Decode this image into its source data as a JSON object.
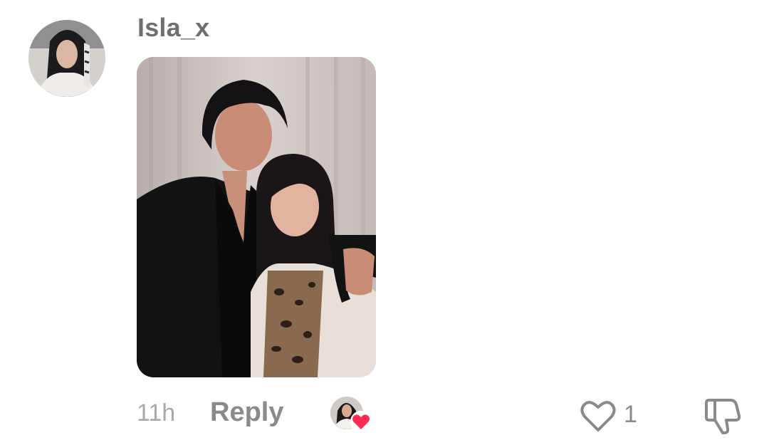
{
  "comment": {
    "username": "Isla_x",
    "timestamp": "11h",
    "reply_label": "Reply",
    "like_count": "1",
    "creator_liked": true,
    "icons": {
      "avatar": "user-avatar",
      "photo": "comment-photo",
      "creator_avatar": "creator-avatar",
      "heart_badge": "heart-icon",
      "like": "heart-outline-icon",
      "dislike": "thumbs-down-icon"
    }
  },
  "colors": {
    "username": "#6f6f6f",
    "muted": "#a9a9a9",
    "reply": "#8a8a8a",
    "heart_badge": "#fe2c55"
  }
}
